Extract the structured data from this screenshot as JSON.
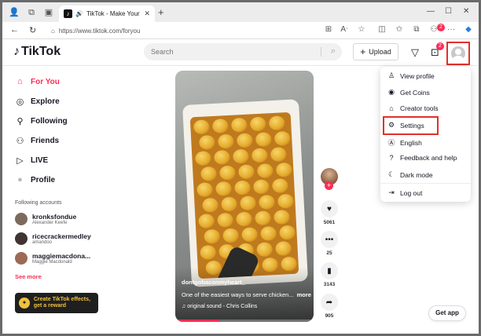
{
  "browser": {
    "tab_title": "TikTok - Make Your Day",
    "url": "https://www.tiktok.com/foryou",
    "extension_badge": "2"
  },
  "header": {
    "logo": "TikTok",
    "search_placeholder": "Search",
    "upload_label": "Upload",
    "inbox_badge": "2"
  },
  "sidebar": {
    "nav": [
      {
        "label": "For You",
        "icon": "home-icon"
      },
      {
        "label": "Explore",
        "icon": "compass-icon"
      },
      {
        "label": "Following",
        "icon": "person-plus-icon"
      },
      {
        "label": "Friends",
        "icon": "friends-icon"
      },
      {
        "label": "LIVE",
        "icon": "live-icon"
      },
      {
        "label": "Profile",
        "icon": "profile-icon"
      }
    ],
    "following_heading": "Following accounts",
    "accounts": [
      {
        "username": "kronksfondue",
        "display": "Alexander Keefe"
      },
      {
        "username": "ricecrackermedley",
        "display": "amandoo"
      },
      {
        "username": "maggiemacdona...",
        "display": "Maggie Macdonald"
      }
    ],
    "see_more": "See more",
    "effects_label": "Create TikTok effects, get a reward"
  },
  "video": {
    "author": "dontgobaconmyheart_",
    "description": "One of the easiest ways to serve chicken...",
    "more": "more",
    "sound": "original sound - Chris Collins",
    "progress": 0.32
  },
  "actions": {
    "likes": "5061",
    "comments": "25",
    "saves": "3143",
    "shares": "905"
  },
  "get_app": "Get app",
  "menu": {
    "items": [
      {
        "label": "View profile",
        "icon": "person-icon"
      },
      {
        "label": "Get Coins",
        "icon": "coin-icon"
      },
      {
        "label": "Creator tools",
        "icon": "creator-tools-icon"
      },
      {
        "label": "Settings",
        "icon": "gear-icon"
      },
      {
        "label": "English",
        "icon": "language-icon"
      },
      {
        "label": "Feedback and help",
        "icon": "help-icon"
      },
      {
        "label": "Dark mode",
        "icon": "moon-icon"
      },
      {
        "label": "Log out",
        "icon": "logout-icon"
      }
    ]
  },
  "colors": {
    "accent": "#fe2c55",
    "highlight": "#e2302b"
  }
}
